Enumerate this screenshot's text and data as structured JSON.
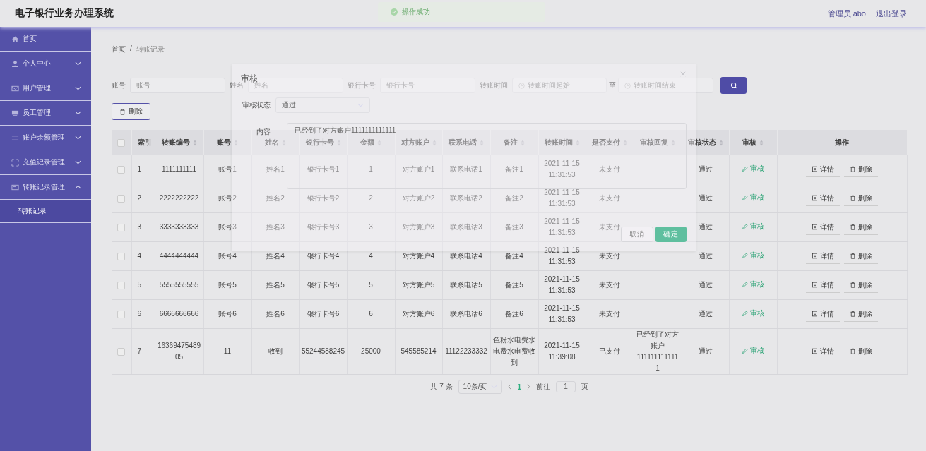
{
  "header": {
    "title": "电子银行业务办理系统",
    "user": "管理员 abo",
    "logout": "退出登录"
  },
  "toast": {
    "message": "操作成功"
  },
  "sidebar": {
    "items": [
      {
        "label": "首页"
      },
      {
        "label": "个人中心",
        "expanded": false
      },
      {
        "label": "用户管理",
        "expanded": false
      },
      {
        "label": "员工管理",
        "expanded": false
      },
      {
        "label": "账户余额管理",
        "expanded": false
      },
      {
        "label": "充值记录管理",
        "expanded": false
      },
      {
        "label": "转账记录管理",
        "expanded": true,
        "children": [
          {
            "label": "转账记录",
            "selected": true
          }
        ]
      }
    ]
  },
  "breadcrumb": {
    "items": [
      "首页",
      "转账记录"
    ],
    "separator": "/"
  },
  "search": {
    "fields": [
      {
        "label": "账号",
        "placeholder": "账号"
      },
      {
        "label": "姓名",
        "placeholder": "姓名"
      },
      {
        "label": "银行卡号",
        "placeholder": "银行卡号"
      }
    ],
    "time_range": {
      "label": "转账时间",
      "start_placeholder": "转账时间起始",
      "separator": "至",
      "end_placeholder": "转账时间结束"
    }
  },
  "delete_button": "删除",
  "table": {
    "select_all_checked": false,
    "columns": [
      {
        "label": "索引",
        "sortable": false
      },
      {
        "label": "转账编号",
        "sortable": true
      },
      {
        "label": "账号",
        "sortable": true
      },
      {
        "label": "姓名",
        "sortable": true
      },
      {
        "label": "银行卡号",
        "sortable": true
      },
      {
        "label": "金额",
        "sortable": true
      },
      {
        "label": "对方账户",
        "sortable": true
      },
      {
        "label": "联系电话",
        "sortable": true
      },
      {
        "label": "备注",
        "sortable": true
      },
      {
        "label": "转账时间",
        "sortable": true
      },
      {
        "label": "是否支付",
        "sortable": true
      },
      {
        "label": "审核回复",
        "sortable": true
      },
      {
        "label": "审核状态",
        "sortable": true
      },
      {
        "label": "审核",
        "sortable": true
      },
      {
        "label": "操作",
        "sortable": false
      }
    ],
    "rows": [
      {
        "selected": false,
        "cells": [
          "1",
          "1111111111",
          "账号1",
          "姓名1",
          "银行卡号1",
          "1",
          "对方账户1",
          "联系电话1",
          "备注1",
          "2021-11-15 11:31:53",
          "未支付",
          "",
          "通过"
        ],
        "review": "审核",
        "actions": [
          "详情",
          "删除"
        ]
      },
      {
        "selected": false,
        "cells": [
          "2",
          "2222222222",
          "账号2",
          "姓名2",
          "银行卡号2",
          "2",
          "对方账户2",
          "联系电话2",
          "备注2",
          "2021-11-15 11:31:53",
          "未支付",
          "",
          "通过"
        ],
        "review": "审核",
        "actions": [
          "详情",
          "删除"
        ]
      },
      {
        "selected": false,
        "cells": [
          "3",
          "3333333333",
          "账号3",
          "姓名3",
          "银行卡号3",
          "3",
          "对方账户3",
          "联系电话3",
          "备注3",
          "2021-11-15 11:31:53",
          "未支付",
          "",
          "通过"
        ],
        "review": "审核",
        "actions": [
          "详情",
          "删除"
        ]
      },
      {
        "selected": false,
        "cells": [
          "4",
          "4444444444",
          "账号4",
          "姓名4",
          "银行卡号4",
          "4",
          "对方账户4",
          "联系电话4",
          "备注4",
          "2021-11-15 11:31:53",
          "未支付",
          "",
          "通过"
        ],
        "review": "审核",
        "actions": [
          "详情",
          "删除"
        ]
      },
      {
        "selected": false,
        "cells": [
          "5",
          "5555555555",
          "账号5",
          "姓名5",
          "银行卡号5",
          "5",
          "对方账户5",
          "联系电话5",
          "备注5",
          "2021-11-15 11:31:53",
          "未支付",
          "",
          "通过"
        ],
        "review": "审核",
        "actions": [
          "详情",
          "删除"
        ]
      },
      {
        "selected": false,
        "cells": [
          "6",
          "6666666666",
          "账号6",
          "姓名6",
          "银行卡号6",
          "6",
          "对方账户6",
          "联系电话6",
          "备注6",
          "2021-11-15 11:31:53",
          "未支付",
          "",
          "通过"
        ],
        "review": "审核",
        "actions": [
          "详情",
          "删除"
        ]
      },
      {
        "selected": false,
        "cells": [
          "7",
          "1636947548905",
          "11",
          "收到",
          "55244588245",
          "25000",
          "545585214",
          "11122233332",
          "色粉水电费水电费水电费收到",
          "2021-11-15 11:39:08",
          "已支付",
          "已经到了对方账户1111111111111",
          "通过"
        ],
        "review": "审核",
        "actions": [
          "详情",
          "删除"
        ]
      }
    ]
  },
  "pagination": {
    "total": "共 7 条",
    "page_size": "10条/页",
    "pages": [
      {
        "label": "1",
        "selected": true
      }
    ],
    "goto_label": "前往",
    "goto_value": "1",
    "goto_suffix": "页"
  },
  "dialog": {
    "title": "审核",
    "status_label": "审核状态",
    "status_value": "通过",
    "content_label": "内容",
    "content_value": "已经到了对方账户1111111111111",
    "buttons": [
      {
        "label": "取消",
        "kind": "cancel"
      },
      {
        "label": "确定",
        "kind": "confirm"
      }
    ]
  }
}
